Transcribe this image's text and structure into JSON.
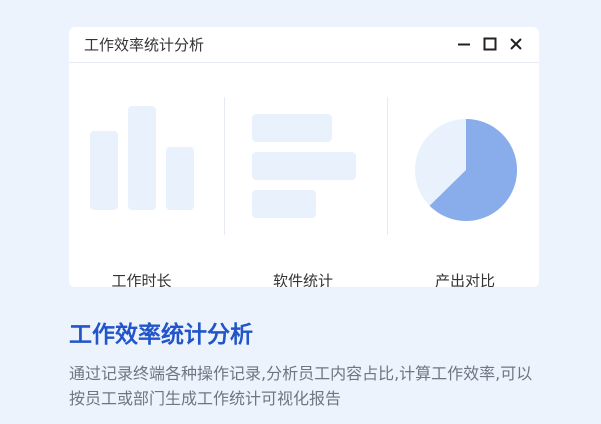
{
  "window": {
    "title": "工作效率统计分析",
    "controls": [
      "minimize-icon",
      "maximize-icon",
      "close-icon"
    ]
  },
  "panels": [
    {
      "label": "工作时长",
      "icon": "bar-chart-icon"
    },
    {
      "label": "软件统计",
      "icon": "horizontal-bar-icon"
    },
    {
      "label": "产出对比",
      "icon": "pie-chart-icon"
    }
  ],
  "feature": {
    "heading": "工作效率统计分析",
    "description": "通过记录终端各种操作记录,分析员工内容占比,计算工作效率,可以按员工或部门生成工作统计可视化报告"
  },
  "colors": {
    "background": "#edf3fd",
    "accent": "#2155c9",
    "pie_fill": "#89acea",
    "placeholder": "#e9f1fd"
  }
}
